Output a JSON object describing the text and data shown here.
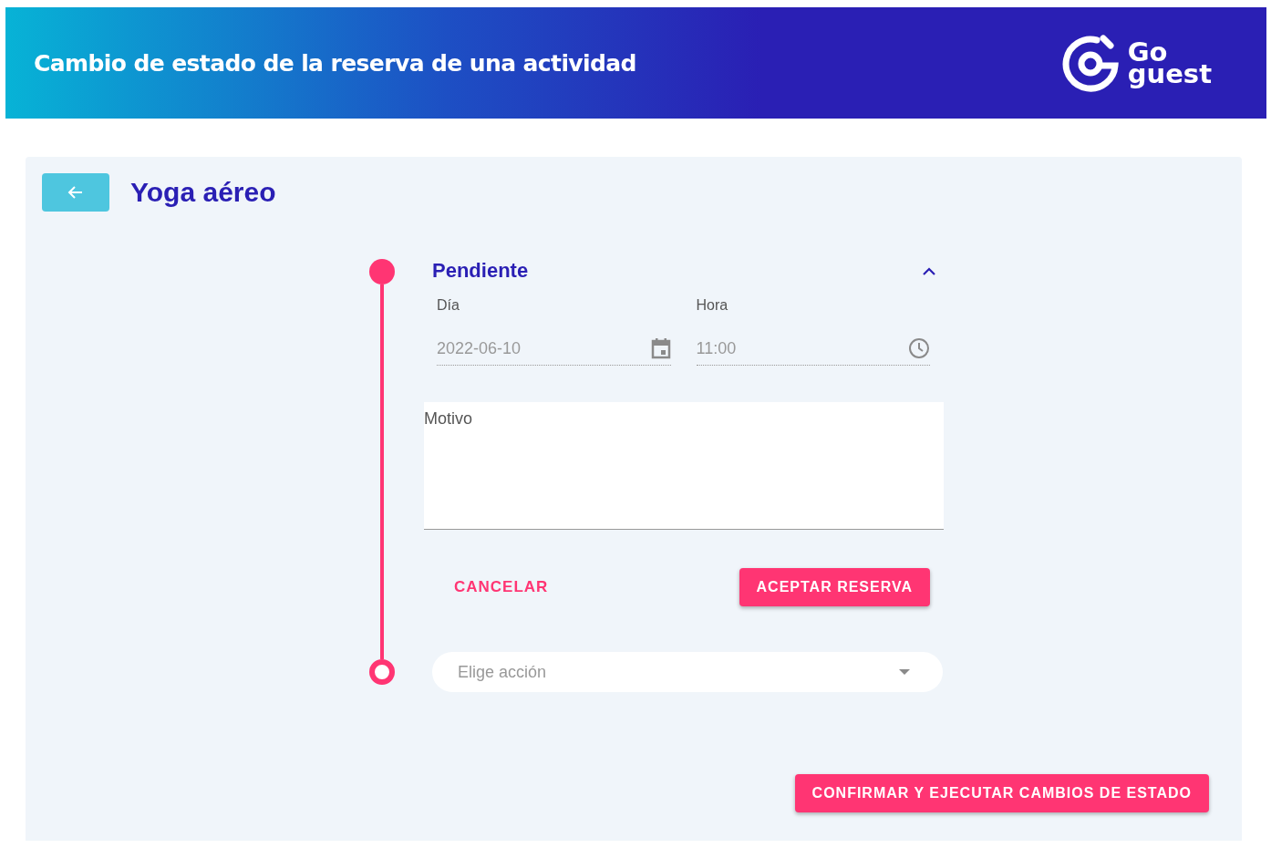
{
  "header": {
    "title": "Cambio de estado de la reserva de una actividad",
    "logo_line_1": "Go",
    "logo_line_2": "guest"
  },
  "page": {
    "title": "Yoga aéreo"
  },
  "steps": [
    {
      "kind": "form",
      "title": "Pendiente",
      "expanded": true,
      "fields": [
        {
          "kind": "date",
          "label": "Día",
          "value": "2022-06-10",
          "disabled": true
        },
        {
          "kind": "time",
          "label": "Hora",
          "value": "11:00",
          "disabled": true
        }
      ],
      "reason": {
        "placeholder": "Motivo"
      },
      "actions": [
        {
          "kind": "text",
          "label": "CANCELAR"
        },
        {
          "kind": "filled",
          "label": "ACEPTAR RESERVA"
        }
      ]
    },
    {
      "kind": "select",
      "placeholder": "Elige acción"
    }
  ],
  "confirm_button": "CONFIRMAR Y EJECUTAR CAMBIOS DE ESTADO"
}
